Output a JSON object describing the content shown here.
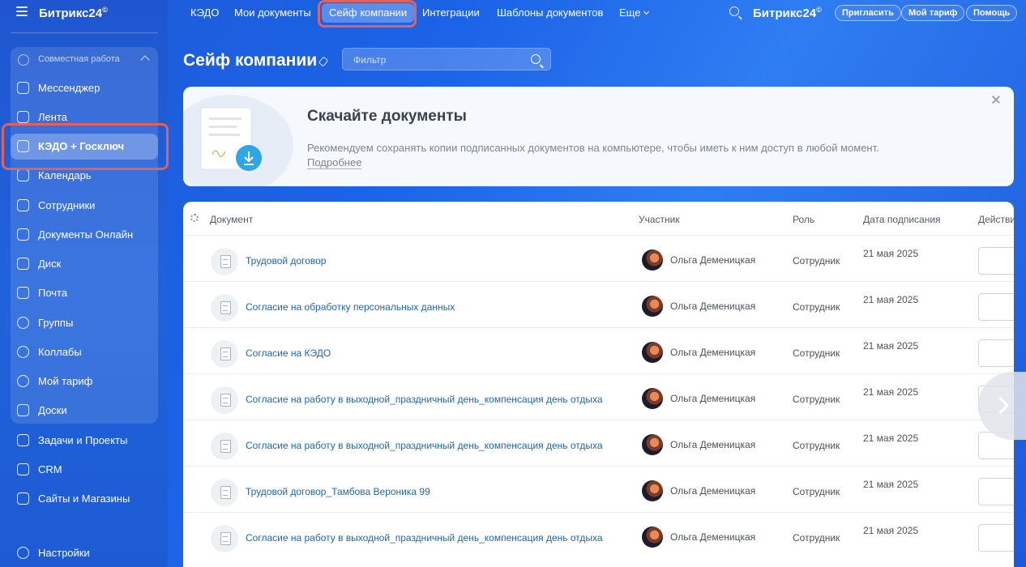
{
  "sidebar": {
    "logo": "Битрикс24",
    "logo_mark": "©",
    "group_label": "Совместная работа",
    "items": [
      {
        "label": "Мессенджер",
        "icon": "chat-icon"
      },
      {
        "label": "Лента",
        "icon": "feed-icon"
      },
      {
        "label": "КЭДО + Госключ",
        "icon": "document-sign-icon",
        "active": true
      },
      {
        "label": "Календарь",
        "icon": "calendar-icon"
      },
      {
        "label": "Сотрудники",
        "icon": "employees-icon"
      },
      {
        "label": "Документы Онлайн",
        "icon": "docs-online-icon"
      },
      {
        "label": "Диск",
        "icon": "disk-icon"
      },
      {
        "label": "Почта",
        "icon": "mail-icon"
      },
      {
        "label": "Группы",
        "icon": "groups-icon"
      },
      {
        "label": "Коллабы",
        "icon": "collab-icon"
      },
      {
        "label": "Мой тариф",
        "icon": "tariff-icon"
      },
      {
        "label": "Доски",
        "icon": "boards-icon"
      },
      {
        "label": "Задачи и Проекты",
        "icon": "tasks-icon"
      },
      {
        "label": "CRM",
        "icon": "crm-icon"
      },
      {
        "label": "Сайты и Магазины",
        "icon": "sites-icon"
      },
      {
        "label": "Настройки",
        "icon": "settings-icon"
      }
    ]
  },
  "topnav": {
    "items": [
      "КЭДО",
      "Мои документы",
      "Сейф компании",
      "Интеграции",
      "Шаблоны документов",
      "Еще"
    ],
    "selected": "Сейф компании",
    "brand": "Битрикс24",
    "brand_mark": "©",
    "buttons": [
      "Пригласить",
      "Мой тариф",
      "Помощь"
    ]
  },
  "page": {
    "title": "Сейф компании",
    "filter_placeholder": "Фильтр"
  },
  "banner": {
    "title": "Скачайте документы",
    "text": "Рекомендуем сохранять копии подписанных документов на компьютере, чтобы иметь к ним доступ в любой момент.",
    "link": "Подробнее"
  },
  "table": {
    "columns": [
      "Документ",
      "Участник",
      "Роль",
      "Дата подписания",
      "Действи"
    ],
    "rows": [
      {
        "document": "Трудовой договор",
        "participant": "Ольга Деменицкая",
        "role": "Сотрудник",
        "date": "21 мая 2025"
      },
      {
        "document": "Согласие на обработку персональных данных",
        "participant": "Ольга Деменицкая",
        "role": "Сотрудник",
        "date": "21 мая 2025"
      },
      {
        "document": "Согласие на КЭДО",
        "participant": "Ольга Деменицкая",
        "role": "Сотрудник",
        "date": "21 мая 2025"
      },
      {
        "document": "Согласие на работу в выходной_праздничный день_компенсация день отдыха",
        "participant": "Ольга Деменицкая",
        "role": "Сотрудник",
        "date": "21 мая 2025"
      },
      {
        "document": "Согласие на работу в выходной_праздничный день_компенсация день отдыха",
        "participant": "Ольга Деменицкая",
        "role": "Сотрудник",
        "date": "21 мая 2025"
      },
      {
        "document": "Трудовой договор_Тамбова Вероника 99",
        "participant": "Ольга Деменицкая",
        "role": "Сотрудник",
        "date": "21 мая 2025"
      },
      {
        "document": "Согласие на работу в выходной_праздничный день_компенсация день отдыха",
        "participant": "Ольга Деменицкая",
        "role": "Сотрудник",
        "date": "21 мая 2025"
      }
    ]
  },
  "colors": {
    "brand_blue": "#1f5ad6",
    "link_blue": "#2067b0",
    "highlight_red": "#e3615c"
  }
}
